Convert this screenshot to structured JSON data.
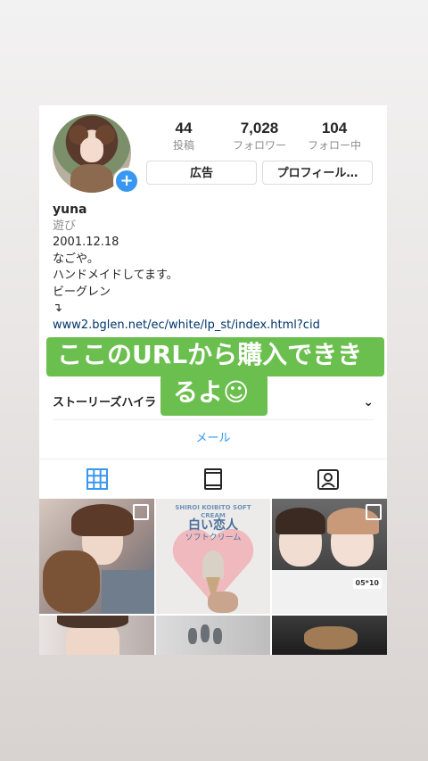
{
  "profile": {
    "stats": [
      {
        "value": "44",
        "label": "投稿"
      },
      {
        "value": "7,028",
        "label": "フォロワー"
      },
      {
        "value": "104",
        "label": "フォロー中"
      }
    ],
    "buttons": {
      "ads": "広告",
      "profile": "プロフィール…"
    },
    "username": "yuna",
    "category": "遊び",
    "bio_lines": [
      "2001.12.18",
      "なごや。",
      "ハンドメイドしてます。",
      "ビーグレン",
      "↴"
    ],
    "link": "www2.bglen.net/ec/white/lp_st/index.html?cid",
    "stories_label": "ストーリーズハイラ",
    "mail_label": "メール",
    "add_symbol": "+"
  },
  "tabs": [
    {
      "icon": "grid-icon",
      "active": true
    },
    {
      "icon": "igtv-icon",
      "active": false
    },
    {
      "icon": "tagged-icon",
      "active": false
    }
  ],
  "grid": {
    "tile2_title": "白い恋人",
    "tile2_sub": "ソフトクリーム",
    "tile2_arc": "SHIROI KOIBITO SOFT CREAM",
    "tile3_date": "05*10"
  },
  "overlay": {
    "line1": "ここのURLから購入できき",
    "line2": "るよ☺"
  },
  "colors": {
    "accent": "#3897f0",
    "overlay_bg": "#6bbf4e",
    "link": "#003569"
  }
}
